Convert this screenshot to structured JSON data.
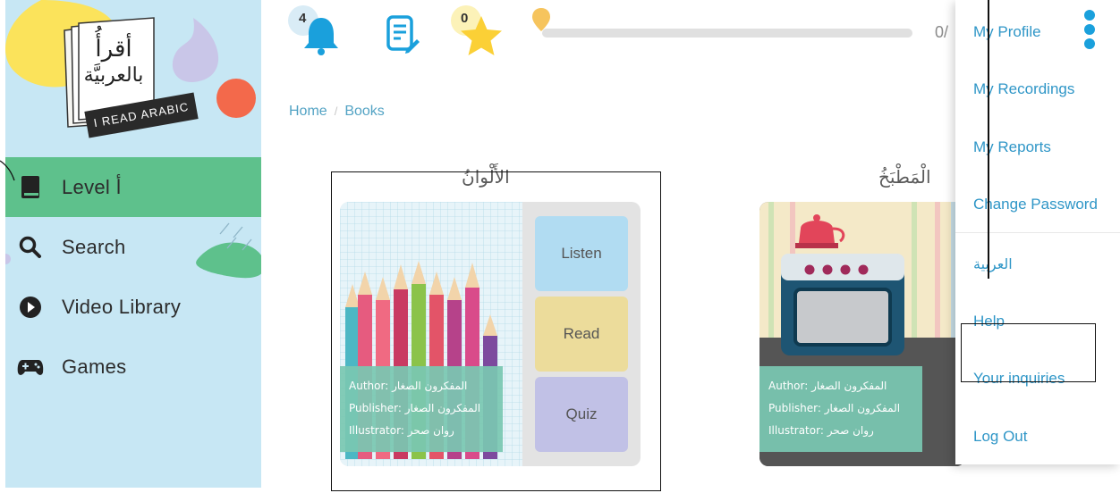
{
  "app": {
    "logo_arabic_line1": "أقرأُ",
    "logo_arabic_line2": "بالعربيَّة",
    "logo_caption": "I READ ARABIC"
  },
  "sidebar": {
    "items": [
      {
        "label": "Level أ",
        "icon": "book-icon",
        "active": true
      },
      {
        "label": "Search",
        "icon": "search-icon",
        "active": false
      },
      {
        "label": "Video Library",
        "icon": "play-icon",
        "active": false
      },
      {
        "label": "Games",
        "icon": "gamepad-icon",
        "active": false
      }
    ]
  },
  "topbar": {
    "notifications_count": "4",
    "stars_count": "0",
    "progress_text": "0/",
    "progress_fraction": 0
  },
  "breadcrumb": {
    "home": "Home",
    "separator": "/",
    "current": "Books"
  },
  "books": [
    {
      "title": "الأَلْوانُ",
      "author_label": "Author:",
      "author": "المفكرون الصغار",
      "publisher_label": "Publisher:",
      "publisher": "المفكرون الصغار",
      "illustrator_label": "Illustrator:",
      "illustrator": "روان صحر",
      "actions": [
        "Listen",
        "Read",
        "Quiz"
      ]
    },
    {
      "title": "الْمَطْبَخُ",
      "author_label": "Author:",
      "author": "المفكرون الصغار",
      "publisher_label": "Publisher:",
      "publisher": "المفكرون الصغار",
      "illustrator_label": "Illustrator:",
      "illustrator": "روان صحر"
    }
  ],
  "menu": {
    "items": [
      "My Profile",
      "My Recordings",
      "My Reports",
      "Change Password",
      "العربية",
      "Help",
      "Your inquiries",
      "Log Out"
    ]
  },
  "colors": {
    "sidebar_bg": "#c7e7f4",
    "active_nav": "#5ec18c",
    "link": "#2f96c7",
    "meta_overlay": "#7ac7b1",
    "listen": "#b1dcf2",
    "read": "#ecdc9b",
    "quiz": "#c1c1e6"
  }
}
